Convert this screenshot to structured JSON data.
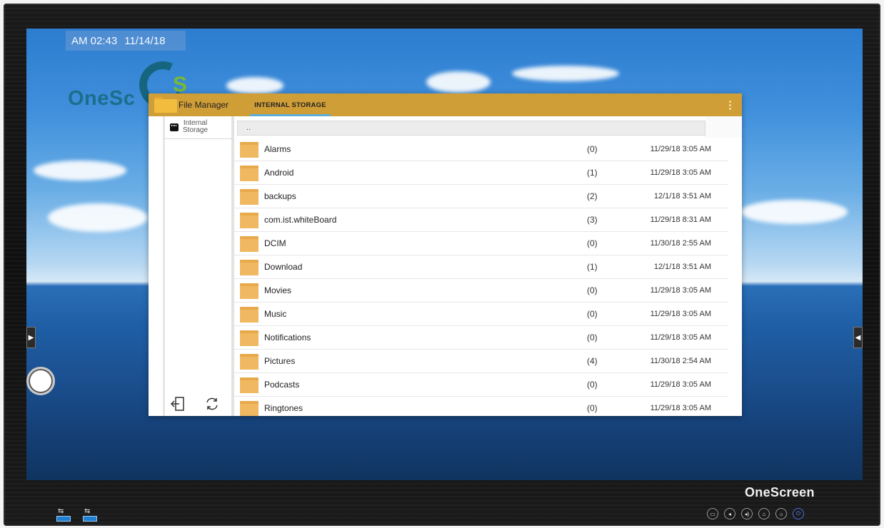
{
  "status": {
    "time": "AM 02:43",
    "date": "11/14/18"
  },
  "brand": {
    "logo_text": "OneSc",
    "bezel_text": "OneScreen"
  },
  "file_manager": {
    "title": "File Manager",
    "tab": "INTERNAL STORAGE",
    "sidebar": {
      "item_label_line1": "Internal",
      "item_label_line2": "Storage"
    },
    "path": "..",
    "rows": [
      {
        "name": "Alarms",
        "count": "(0)",
        "date": "11/29/18 3:05 AM"
      },
      {
        "name": "Android",
        "count": "(1)",
        "date": "11/29/18 3:05 AM"
      },
      {
        "name": "backups",
        "count": "(2)",
        "date": "12/1/18 3:51 AM"
      },
      {
        "name": "com.ist.whiteBoard",
        "count": "(3)",
        "date": "11/29/18 8:31 AM"
      },
      {
        "name": "DCIM",
        "count": "(0)",
        "date": "11/30/18 2:55 AM"
      },
      {
        "name": "Download",
        "count": "(1)",
        "date": "12/1/18 3:51 AM"
      },
      {
        "name": "Movies",
        "count": "(0)",
        "date": "11/29/18 3:05 AM"
      },
      {
        "name": "Music",
        "count": "(0)",
        "date": "11/29/18 3:05 AM"
      },
      {
        "name": "Notifications",
        "count": "(0)",
        "date": "11/29/18 3:05 AM"
      },
      {
        "name": "Pictures",
        "count": "(4)",
        "date": "11/30/18 2:54 AM"
      },
      {
        "name": "Podcasts",
        "count": "(0)",
        "date": "11/29/18 3:05 AM"
      },
      {
        "name": "Ringtones",
        "count": "(0)",
        "date": "11/29/18 3:05 AM"
      }
    ]
  },
  "icons": {
    "header": "folder-icon",
    "menu": "more-vert-icon",
    "sidebar": "sd-card-icon",
    "exit": "exit-icon",
    "refresh": "refresh-icon",
    "controls": [
      "input-source-icon",
      "volume-down-icon",
      "volume-up-icon",
      "home-icon",
      "brightness-icon",
      "power-icon"
    ]
  },
  "colors": {
    "header": "#d09e37",
    "tab_indicator": "#5aaed8",
    "folder": "#f0b860",
    "usb_port": "#1f7fd3"
  }
}
